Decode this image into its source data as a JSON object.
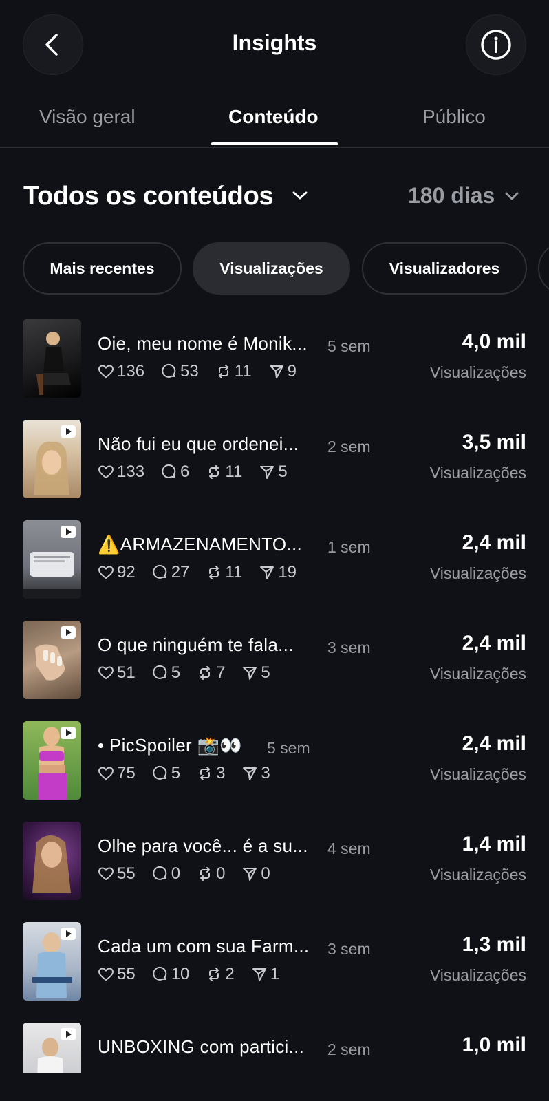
{
  "header": {
    "title": "Insights"
  },
  "tabs": [
    {
      "label": "Visão geral"
    },
    {
      "label": "Conteúdo"
    },
    {
      "label": "Público"
    }
  ],
  "section": {
    "title": "Todos os conteúdos",
    "period": "180 dias"
  },
  "filters": [
    {
      "label": "Mais recentes"
    },
    {
      "label": "Visualizações"
    },
    {
      "label": "Visualizadores"
    }
  ],
  "posts": [
    {
      "caption": "Oie, meu nome é Monik...",
      "age": "5 sem",
      "likes": "136",
      "comments": "53",
      "reposts": "11",
      "shares": "9",
      "value": "4,0 mil",
      "value_label": "Visualizações"
    },
    {
      "caption": "Não fui eu que ordenei...",
      "age": "2 sem",
      "likes": "133",
      "comments": "6",
      "reposts": "11",
      "shares": "5",
      "value": "3,5 mil",
      "value_label": "Visualizações"
    },
    {
      "caption": "⚠️ARMAZENAMENTO...",
      "age": "1 sem",
      "likes": "92",
      "comments": "27",
      "reposts": "11",
      "shares": "19",
      "value": "2,4 mil",
      "value_label": "Visualizações"
    },
    {
      "caption": "O que ninguém te fala...",
      "age": "3 sem",
      "likes": "51",
      "comments": "5",
      "reposts": "7",
      "shares": "5",
      "value": "2,4 mil",
      "value_label": "Visualizações"
    },
    {
      "caption": "• PicSpoiler 📸👀",
      "age": "5 sem",
      "likes": "75",
      "comments": "5",
      "reposts": "3",
      "shares": "3",
      "value": "2,4 mil",
      "value_label": "Visualizações"
    },
    {
      "caption": "Olhe para você... é a su...",
      "age": "4 sem",
      "likes": "55",
      "comments": "0",
      "reposts": "0",
      "shares": "0",
      "value": "1,4 mil",
      "value_label": "Visualizações"
    },
    {
      "caption": "Cada um com sua Farm...",
      "age": "3 sem",
      "likes": "55",
      "comments": "10",
      "reposts": "2",
      "shares": "1",
      "value": "1,3 mil",
      "value_label": "Visualizações"
    },
    {
      "caption": "UNBOXING com partici...",
      "age": "2 sem",
      "likes": "",
      "comments": "",
      "reposts": "",
      "shares": "",
      "value": "1,0 mil",
      "value_label": ""
    }
  ],
  "colors": {
    "background": "#0f1116",
    "muted": "#9a9ca3"
  }
}
